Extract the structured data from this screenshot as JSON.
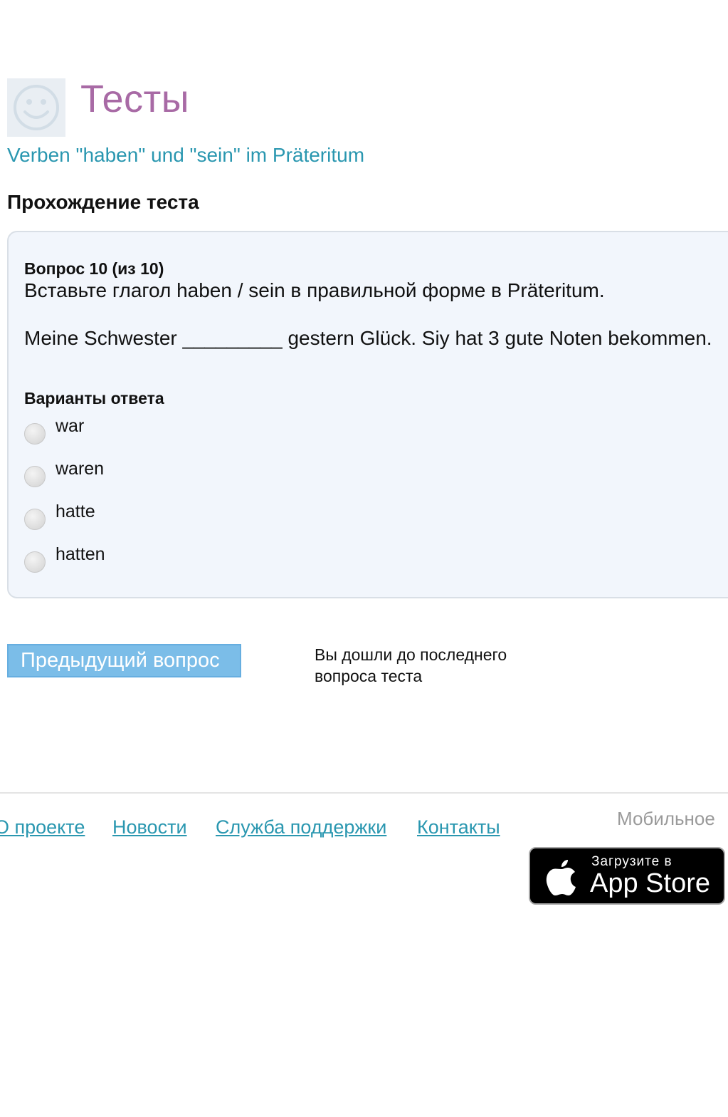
{
  "header": {
    "logo_icon": "smiley-icon",
    "title": "Тесты",
    "test_name": "Verben \"haben\" und \"sein\" im Präteritum",
    "section_title": "Прохождение теста"
  },
  "question": {
    "number_label": "Вопрос 10 (из 10)",
    "instruction": "Вставьте глагол haben / sein в правильной форме в Präteritum.",
    "sentence": "Meine Schwester _________ gestern Glück. Siy hat 3 gute Noten bekommen.",
    "answers_title": "Варианты ответа",
    "options": [
      {
        "label": "war",
        "selected": false
      },
      {
        "label": "waren",
        "selected": false
      },
      {
        "label": "hatte",
        "selected": false
      },
      {
        "label": "hatten",
        "selected": false
      }
    ]
  },
  "navigation": {
    "prev_button": "Предыдущий вопрос",
    "last_question_note": "Вы дошли до последнего вопроса теста"
  },
  "footer": {
    "links": [
      "О проекте",
      "Новости",
      "Служба поддержки",
      "Контакты"
    ],
    "mobile_label": "Мобильное",
    "appstore": {
      "top_text": "Загрузите в",
      "main_text": "App Store",
      "icon": "apple-icon"
    }
  },
  "colors": {
    "title": "#a86aa5",
    "link": "#2a97b0",
    "card_bg": "#f2f6fc",
    "button_bg": "#7bbde8"
  }
}
